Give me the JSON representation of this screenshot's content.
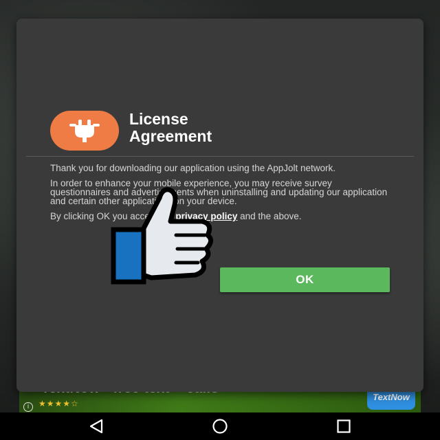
{
  "background_ad": {
    "title": "TextNow - free text + calls",
    "rating_stars": "★★★★☆",
    "info_glyph": "i",
    "badge_text": "TextNow"
  },
  "dialog": {
    "title": "License\nAgreement",
    "icon": "plug-icon",
    "accent_color": "#ef7b45",
    "paragraph1": "Thank you for downloading our application using the AppJolt network.",
    "paragraph2": "In order to enhance your mobile experience, you may receive survey questionnaires and advertisements when uninstalling and updating our application and certain other applications on your device.",
    "paragraph3_before": "By clicking OK you accept the ",
    "privacy_link": "privacy policy",
    "paragraph3_after": " and the above.",
    "ok_label": "OK",
    "ok_color": "#5cb85c"
  },
  "overlay": {
    "icon": "thumbs-up-icon"
  },
  "navbar": {
    "back_icon": "back-icon",
    "home_icon": "home-icon",
    "recents_icon": "recents-icon"
  }
}
